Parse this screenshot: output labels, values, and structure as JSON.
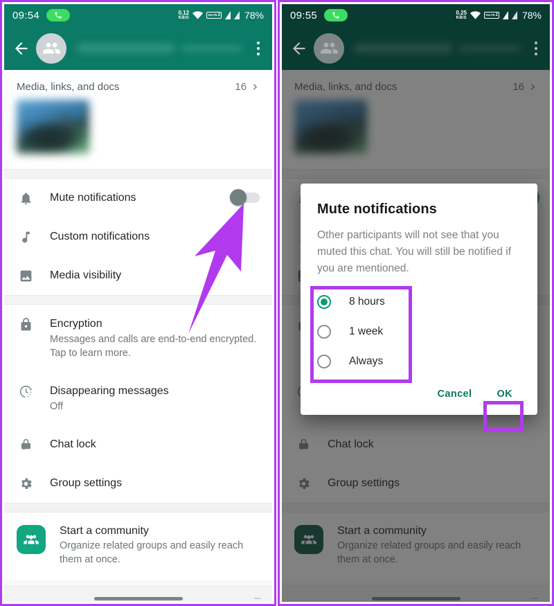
{
  "left_panel": {
    "statusbar": {
      "time": "09:54",
      "data_rate_value": "0.12",
      "data_rate_unit": "KB/S",
      "volte_label_top": "VoLTE",
      "volte_label_sim": "2",
      "battery": "78%",
      "icons": [
        "call-pill-icon",
        "wifi-icon",
        "volte-icon",
        "signal-icon",
        "signal-icon"
      ]
    },
    "appbar": {
      "back": "back-arrow-icon",
      "avatar": "group-avatar-icon",
      "title": "",
      "menu": "overflow-menu-icon"
    },
    "media": {
      "label": "Media, links, and docs",
      "count": "16",
      "chevron": "chevron-right-icon"
    },
    "settings_rows": [
      {
        "icon": "bell-icon",
        "title": "Mute notifications",
        "subtitle": "",
        "control": "toggle-off"
      },
      {
        "icon": "music-note-icon",
        "title": "Custom notifications",
        "subtitle": "",
        "control": ""
      },
      {
        "icon": "image-icon",
        "title": "Media visibility",
        "subtitle": "",
        "control": ""
      }
    ],
    "privacy_rows": [
      {
        "icon": "lock-icon",
        "title": "Encryption",
        "subtitle": "Messages and calls are end-to-end encrypted. Tap to learn more."
      },
      {
        "icon": "timer-icon",
        "title": "Disappearing messages",
        "subtitle": "Off"
      },
      {
        "icon": "chat-lock-icon",
        "title": "Chat lock",
        "subtitle": ""
      },
      {
        "icon": "gear-icon",
        "title": "Group settings",
        "subtitle": ""
      }
    ],
    "community": {
      "icon": "community-icon",
      "title": "Start a community",
      "subtitle": "Organize related groups and easily reach them at once."
    }
  },
  "right_panel": {
    "statusbar": {
      "time": "09:55",
      "data_rate_value": "0.25",
      "data_rate_unit": "KB/S",
      "volte_label_top": "VoLTE",
      "volte_label_sim": "2",
      "battery": "78%"
    },
    "media": {
      "label": "Media, links, and docs",
      "count": "16"
    },
    "rows_behind": [
      {
        "icon": "chat-lock-icon",
        "title": "Chat lock"
      },
      {
        "icon": "gear-icon",
        "title": "Group settings"
      }
    ],
    "community": {
      "title": "Start a community",
      "subtitle": "Organize related groups and easily reach them at once."
    },
    "dialog": {
      "title": "Mute notifications",
      "body": "Other participants will not see that you muted this chat. You will still be notified if you are mentioned.",
      "options": [
        {
          "label": "8 hours",
          "selected": true
        },
        {
          "label": "1 week",
          "selected": false
        },
        {
          "label": "Always",
          "selected": false
        }
      ],
      "cancel_label": "Cancel",
      "ok_label": "OK"
    }
  },
  "annotations": {
    "accent_color": "#b23aee",
    "arrow": "pointer-arrow",
    "highlight_radios": "radio-group-highlight",
    "highlight_ok": "ok-button-highlight",
    "highlight_toggle": "mute-toggle-pointer"
  },
  "theme": {
    "whatsapp_green": "#0b7a66",
    "dim_green": "#0a3b33",
    "accent_teal": "#0a9c78",
    "community_green": "#12a683"
  }
}
